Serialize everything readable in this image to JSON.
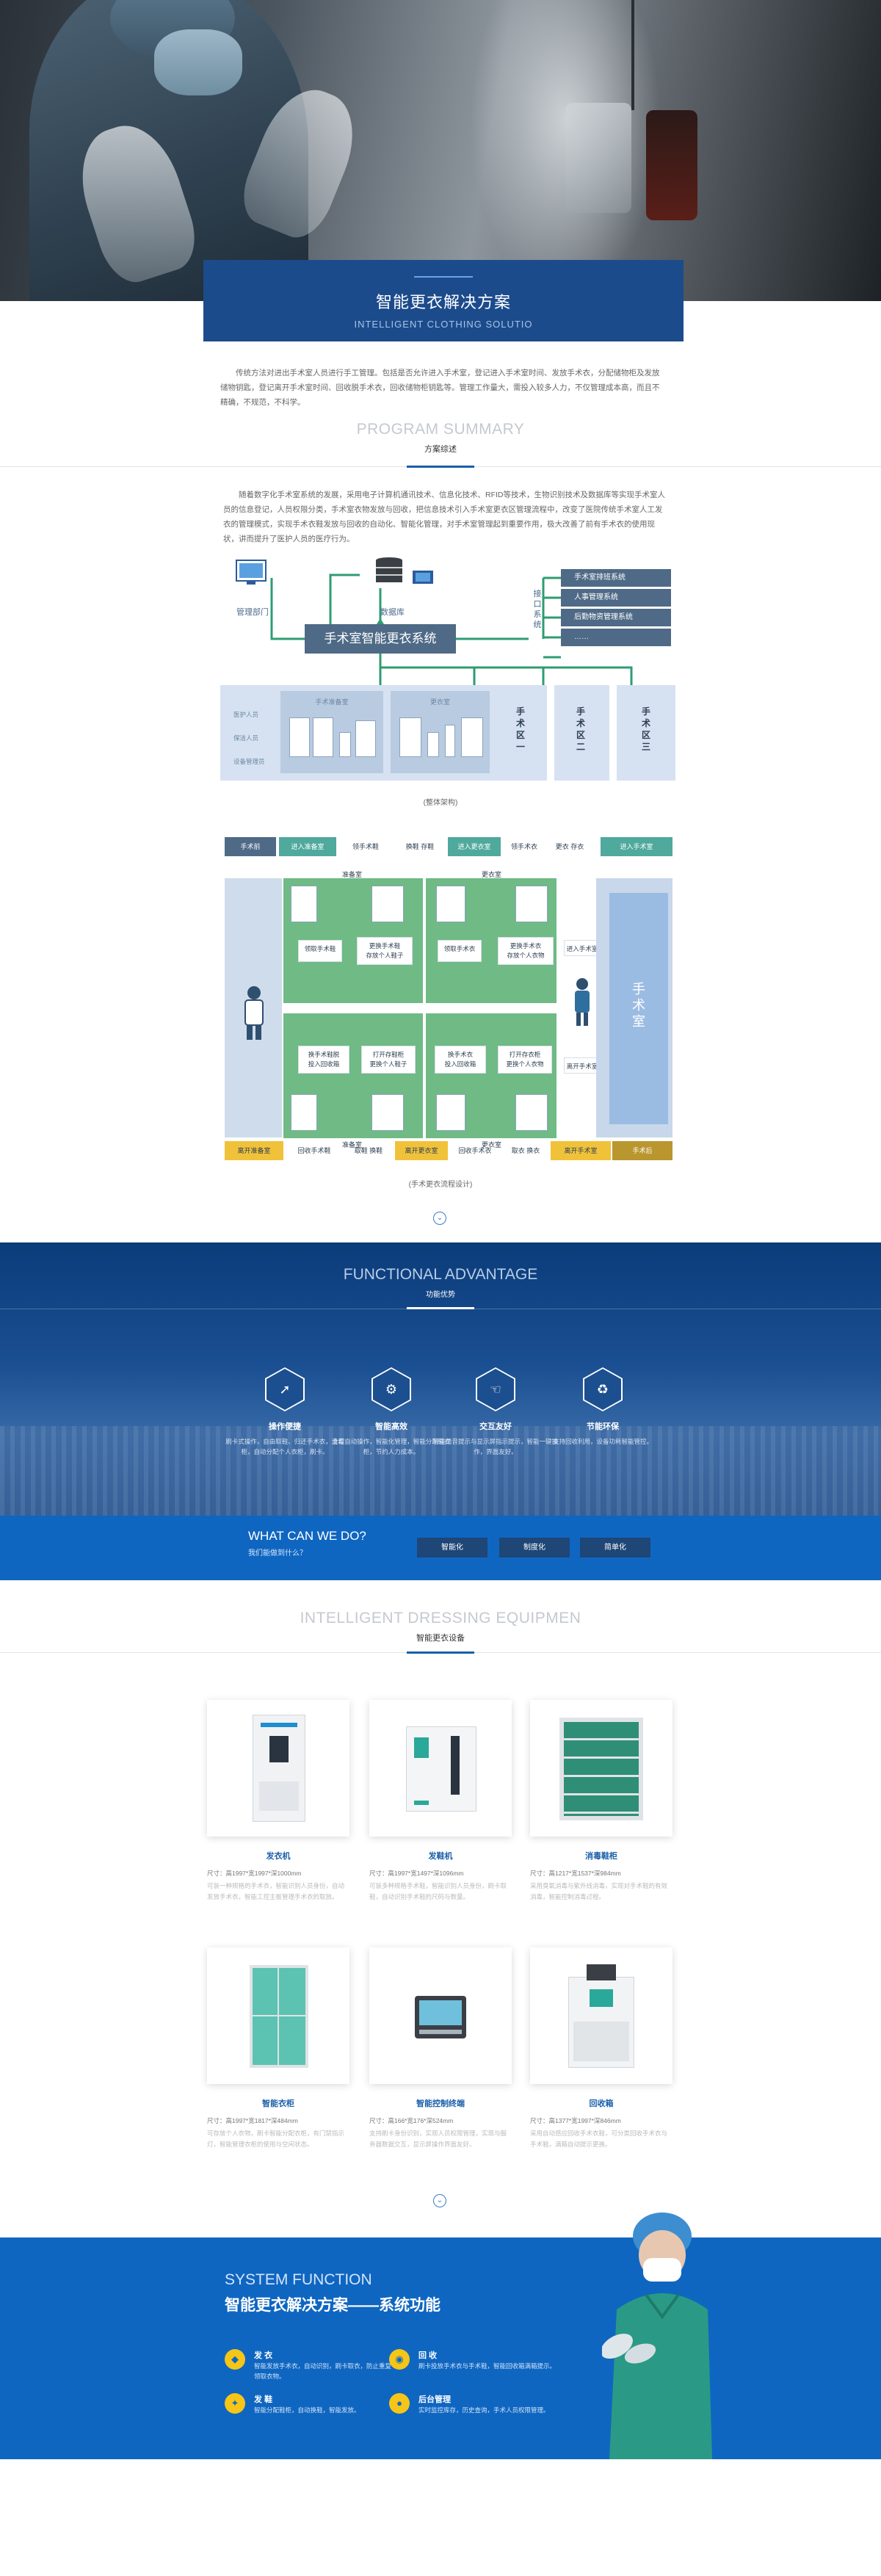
{
  "hero": {
    "title_cn": "智能更衣解决方案",
    "title_en": "INTELLIGENT CLOTHING SOLUTIO"
  },
  "intro": "传统方法对进出手术室人员进行手工管理。包括是否允许进入手术室，登记进入手术室时间、发放手术衣，分配储物柜及发放储物钥匙，登记离开手术室时间、回收脱手术衣，回收储物柜钥匙等。管理工作量大，需投入较多人力，不仅管理成本高，而且不精确，不规范，不科学。",
  "summary_section": {
    "en": "PROGRAM SUMMARY",
    "cn": "方案综述",
    "text": "随着数字化手术室系统的发展，采用电子计算机通讯技术、信息化技术、RFID等技术，生物识别技术及数据库等实现手术室人员的信息登记，人员权限分类，手术室衣物发放与回收，把信息技术引入手术室更衣区管理流程中，改变了医院传统手术室人工发衣的管理模式，实现手术衣鞋发放与回收的自动化、智能化管理，对手术室管理起到重要作用，极大改善了前有手术衣的使用现状，讲而提升了医护人员的医疗行为。"
  },
  "architecture": {
    "dept": "管理部门",
    "db": "数据库",
    "system": "手术室智能更衣系统",
    "interface": "接口系统",
    "right_items": [
      "手术室排班系统",
      "人事管理系统",
      "后勤物资管理系统",
      "……"
    ],
    "panel_left_title": "手术准备室",
    "panel_right_title": "更衣室",
    "side_labels": [
      "医护人员",
      "保洁人员",
      "设备管理员"
    ],
    "zones": [
      "手术区一",
      "手术区二",
      "手术区三"
    ],
    "caption": "(整体架构)"
  },
  "flow": {
    "top_steps": [
      "手术前",
      "进入准备室",
      "领手术鞋",
      "换鞋 存鞋",
      "进入更衣室",
      "领手术衣",
      "更衣 存衣",
      "进入手术室"
    ],
    "bottom_steps": [
      "离开准备室",
      "回收手术鞋",
      "取鞋 换鞋",
      "离开更衣室",
      "回收手术衣",
      "取衣 换衣",
      "离开手术室",
      "手术后"
    ],
    "room_labels": [
      "准备室",
      "更衣室",
      "准备室",
      "更衣室"
    ],
    "cards": [
      "领取手术鞋",
      "更换手术鞋\n存放个人鞋子",
      "领取手术衣",
      "更换手术衣\n存放个人衣物",
      "换手术鞋脱\n投入回收箱",
      "打开存鞋柜\n更换个人鞋子",
      "换手术衣\n投入回收箱",
      "打开存衣柜\n更换个人衣物"
    ],
    "side_cards": [
      "进入手术室",
      "离开手术室"
    ],
    "operating_room": "手术室",
    "caption": "(手术更衣流程设计)"
  },
  "advantage": {
    "en": "FUNCTIONAL ADVANTAGE",
    "cn": "功能优势",
    "items": [
      {
        "icon": "rocket-icon",
        "glyph": "➚",
        "title": "操作便捷",
        "desc": "刷卡式操作，自由取鞋、归还手术衣，清毒柜，自动分配个人衣柜，刷卡。"
      },
      {
        "icon": "gear-icon",
        "glyph": "⚙",
        "title": "智能高效",
        "desc": "全程自动操作，智能化管理，智能分配鞋衣柜，节约人力成本。"
      },
      {
        "icon": "hand-icon",
        "glyph": "☜",
        "title": "交互友好",
        "desc": "智能语音提示与显示屏指示提示，智能一键操作，界面友好。"
      },
      {
        "icon": "recycle-icon",
        "glyph": "♻",
        "title": "节能环保",
        "desc": "支持回收利用，设备功耗智能管控。"
      }
    ]
  },
  "cando": {
    "en": "WHAT CAN WE DO?",
    "cn": "我们能做到什么？",
    "buttons": [
      "智能化",
      "制度化",
      "简单化"
    ]
  },
  "equipment": {
    "en": "INTELLIGENT DRESSING EQUIPMEN",
    "cn": "智能更衣设备",
    "products": [
      {
        "name": "发衣机",
        "spec": "尺寸：高1997*宽1997*深1000mm",
        "desc": "可装一种规格的手术衣，智能识别人员身份，自动发放手术衣，智能工控主板管理手术衣的取放。"
      },
      {
        "name": "发鞋机",
        "spec": "尺寸：高1997*宽1497*深1096mm",
        "desc": "可装多种规格手术鞋，智能识别人员身份，刷卡取鞋，自动识别手术鞋的尺码与数量。"
      },
      {
        "name": "消毒鞋柜",
        "spec": "尺寸：高1217*宽1537*深984mm",
        "desc": "采用臭氧消毒与紫外线消毒，实现对手术鞋的有效消毒，智能控制消毒过程。"
      },
      {
        "name": "智能衣柜",
        "spec": "尺寸：高1997*宽1817*深484mm",
        "desc": "可存放个人衣物，刷卡智能分配衣柜，有门禁指示灯，智能管理衣柜的使用与空闲状态。"
      },
      {
        "name": "智能控制终端",
        "spec": "尺寸：高166*宽176*深524mm",
        "desc": "支持刷卡身份识别，实现人员权限管理，实现与服务器数据交互，显示屏操作界面友好。"
      },
      {
        "name": "回收箱",
        "spec": "尺寸：高1377*宽1997*深846mm",
        "desc": "采用自动感应回收手术衣鞋，可分类回收手术衣与手术鞋，满箱自动提示更换。"
      }
    ]
  },
  "system_function": {
    "en": "SYSTEM FUNCTION",
    "cn": "智能更衣解决方案——系统功能",
    "items": [
      {
        "title": "发 衣",
        "desc": "智能发放手术衣，自动识别，刷卡取衣，防止重复领取衣物。"
      },
      {
        "title": "回 收",
        "desc": "刷卡投放手术衣与手术鞋，智能回收箱满箱提示。"
      },
      {
        "title": "发 鞋",
        "desc": "智能分配鞋柜，自动换鞋，智能发放。"
      },
      {
        "title": "后台管理",
        "desc": "实时监控库存，历史查询，手术人员权限管理。"
      }
    ]
  }
}
